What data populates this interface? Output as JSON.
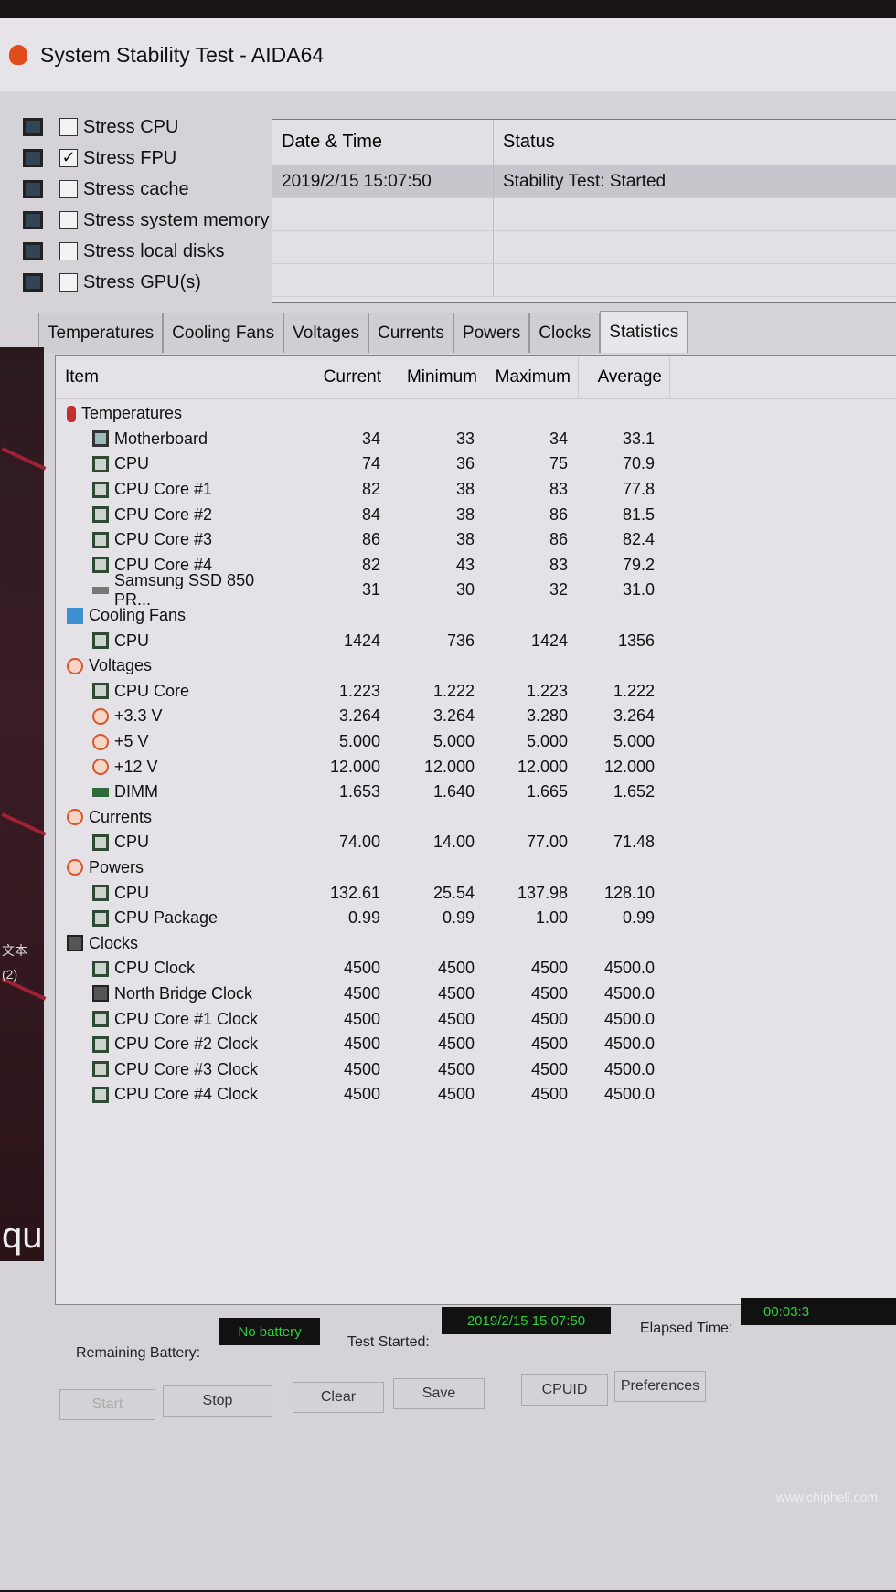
{
  "window": {
    "title": "System Stability Test - AIDA64"
  },
  "stress_options": [
    {
      "label": "Stress CPU",
      "checked": false
    },
    {
      "label": "Stress FPU",
      "checked": true
    },
    {
      "label": "Stress cache",
      "checked": false
    },
    {
      "label": "Stress system memory",
      "checked": false
    },
    {
      "label": "Stress local disks",
      "checked": false
    },
    {
      "label": "Stress GPU(s)",
      "checked": false
    }
  ],
  "log": {
    "headers": [
      "Date & Time",
      "Status"
    ],
    "rows": [
      [
        "2019/2/15 15:07:50",
        "Stability Test: Started"
      ]
    ]
  },
  "tabs": [
    "Temperatures",
    "Cooling Fans",
    "Voltages",
    "Currents",
    "Powers",
    "Clocks",
    "Statistics"
  ],
  "active_tab": "Statistics",
  "stats": {
    "headers": [
      "Item",
      "Current",
      "Minimum",
      "Maximum",
      "Average"
    ],
    "rows": [
      {
        "label": "Temperatures",
        "icon": "therm",
        "group": true
      },
      {
        "label": "Motherboard",
        "icon": "mb",
        "values": [
          "34",
          "33",
          "34",
          "33.1"
        ]
      },
      {
        "label": "CPU",
        "icon": "chip",
        "values": [
          "74",
          "36",
          "75",
          "70.9"
        ]
      },
      {
        "label": "CPU Core #1",
        "icon": "chip",
        "values": [
          "82",
          "38",
          "83",
          "77.8"
        ]
      },
      {
        "label": "CPU Core #2",
        "icon": "chip",
        "values": [
          "84",
          "38",
          "86",
          "81.5"
        ]
      },
      {
        "label": "CPU Core #3",
        "icon": "chip",
        "values": [
          "86",
          "38",
          "86",
          "82.4"
        ]
      },
      {
        "label": "CPU Core #4",
        "icon": "chip",
        "values": [
          "82",
          "43",
          "83",
          "79.2"
        ]
      },
      {
        "label": "Samsung SSD 850 PR...",
        "icon": "disk",
        "values": [
          "31",
          "30",
          "32",
          "31.0"
        ]
      },
      {
        "label": "Cooling Fans",
        "icon": "fan",
        "group": true
      },
      {
        "label": "CPU",
        "icon": "chip",
        "values": [
          "1424",
          "736",
          "1424",
          "1356"
        ]
      },
      {
        "label": "Voltages",
        "icon": "volt",
        "group": true
      },
      {
        "label": "CPU Core",
        "icon": "chip",
        "values": [
          "1.223",
          "1.222",
          "1.223",
          "1.222"
        ]
      },
      {
        "label": "+3.3 V",
        "icon": "volt",
        "values": [
          "3.264",
          "3.264",
          "3.280",
          "3.264"
        ]
      },
      {
        "label": "+5 V",
        "icon": "volt",
        "values": [
          "5.000",
          "5.000",
          "5.000",
          "5.000"
        ]
      },
      {
        "label": "+12 V",
        "icon": "volt",
        "values": [
          "12.000",
          "12.000",
          "12.000",
          "12.000"
        ]
      },
      {
        "label": "DIMM",
        "icon": "dimm",
        "values": [
          "1.653",
          "1.640",
          "1.665",
          "1.652"
        ]
      },
      {
        "label": "Currents",
        "icon": "volt",
        "group": true
      },
      {
        "label": "CPU",
        "icon": "chip",
        "values": [
          "74.00",
          "14.00",
          "77.00",
          "71.48"
        ]
      },
      {
        "label": "Powers",
        "icon": "volt",
        "group": true
      },
      {
        "label": "CPU",
        "icon": "chip",
        "values": [
          "132.61",
          "25.54",
          "137.98",
          "128.10"
        ]
      },
      {
        "label": "CPU Package",
        "icon": "chip",
        "values": [
          "0.99",
          "0.99",
          "1.00",
          "0.99"
        ]
      },
      {
        "label": "Clocks",
        "icon": "clock",
        "group": true
      },
      {
        "label": "CPU Clock",
        "icon": "chip",
        "values": [
          "4500",
          "4500",
          "4500",
          "4500.0"
        ]
      },
      {
        "label": "North Bridge Clock",
        "icon": "clock",
        "values": [
          "4500",
          "4500",
          "4500",
          "4500.0"
        ]
      },
      {
        "label": "CPU Core #1 Clock",
        "icon": "chip",
        "values": [
          "4500",
          "4500",
          "4500",
          "4500.0"
        ]
      },
      {
        "label": "CPU Core #2 Clock",
        "icon": "chip",
        "values": [
          "4500",
          "4500",
          "4500",
          "4500.0"
        ]
      },
      {
        "label": "CPU Core #3 Clock",
        "icon": "chip",
        "values": [
          "4500",
          "4500",
          "4500",
          "4500.0"
        ]
      },
      {
        "label": "CPU Core #4 Clock",
        "icon": "chip",
        "values": [
          "4500",
          "4500",
          "4500",
          "4500.0"
        ]
      }
    ]
  },
  "status": {
    "battery_label": "Remaining Battery:",
    "battery_value": "No battery",
    "started_label": "Test Started:",
    "started_value": "2019/2/15 15:07:50",
    "elapsed_label": "Elapsed Time:",
    "elapsed_value": "00:03:3"
  },
  "buttons": [
    "Start",
    "Stop",
    "Clear",
    "Save",
    "CPUID",
    "Preferences"
  ],
  "desktop": {
    "side_text": [
      "文本",
      "(2)",
      "qu"
    ]
  },
  "watermark": {
    "logo": "chip hell",
    "url": "www.chiphell.com"
  },
  "colors": {
    "lcd_text": "#2ed13a",
    "lcd_bg": "#111111"
  }
}
